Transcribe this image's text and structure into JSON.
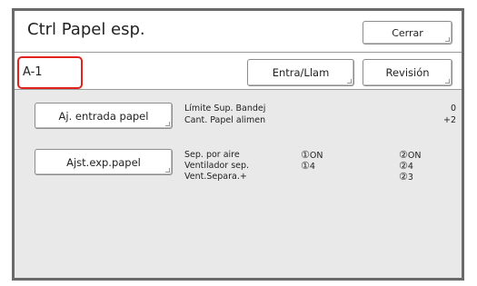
{
  "header": {
    "title": "Ctrl Papel esp.",
    "close_label": "Cerrar"
  },
  "subbar": {
    "code": "A-1",
    "entra_label": "Entra/Llam",
    "revision_label": "Revisión"
  },
  "section1": {
    "button_label": "Aj. entrada papel",
    "rows": [
      {
        "label": "Límite Sup. Bandej",
        "value": "0"
      },
      {
        "label": "Cant. Papel alimen",
        "value": "+2"
      }
    ]
  },
  "section2": {
    "button_label": "Ajst.exp.papel",
    "rows": [
      {
        "label": "Sep. por aire",
        "col1_num": "①",
        "col1_val": "ON",
        "col2_num": "②",
        "col2_val": "ON"
      },
      {
        "label": "Ventilador sep.",
        "col1_num": "①",
        "col1_val": "4",
        "col2_num": "②",
        "col2_val": "4"
      },
      {
        "label": "Vent.Separa.+",
        "col1_num": "",
        "col1_val": "",
        "col2_num": "②",
        "col2_val": "3"
      }
    ]
  },
  "colors": {
    "highlight_border": "#e0231c",
    "panel_bg": "#e9e9e9"
  }
}
